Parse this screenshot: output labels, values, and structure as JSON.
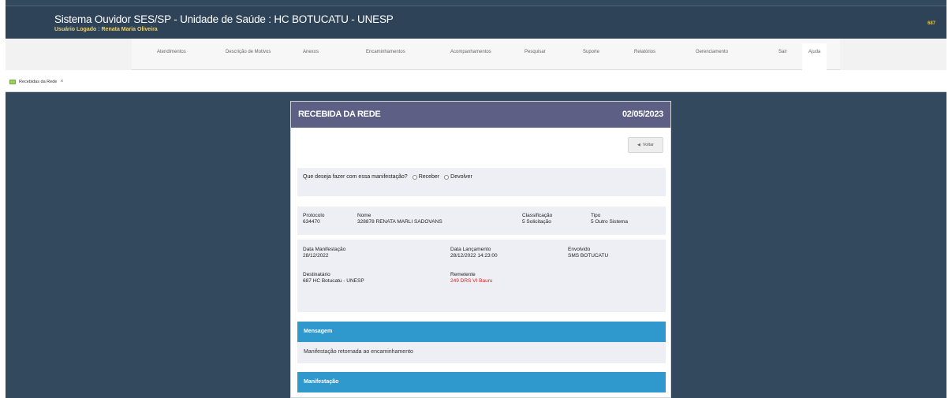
{
  "header": {
    "title": "Sistema Ouvidor SES/SP - Unidade de Saúde : HC BOTUCATU - UNESP",
    "user_label": "Usuário Logado : ",
    "user_name": "Renata Maria Oliveira",
    "code": "687"
  },
  "nav": {
    "items": [
      "Atendimentos",
      "Descrição de Motivos",
      "Anexos",
      "Encaminhamentos",
      "Acompanhamentos",
      "Pesquisar",
      "Suporte",
      "Relatórios",
      "Gerenciamento",
      "Sair",
      "Ajuda"
    ]
  },
  "tabs": [
    {
      "label": "Recebidas da Rede",
      "close": "×"
    }
  ],
  "card": {
    "title": "RECEBIDA DA REDE",
    "date": "02/05/2023",
    "back_label": "Voltar",
    "question": "Que deseja fazer com essa manifestação?",
    "options": [
      "Receber",
      "Devolver"
    ],
    "protocolo": {
      "label": "Protocolo",
      "value": "634470"
    },
    "nome": {
      "label": "Nome",
      "value": "328878 RENATA MARLI SADOVANS"
    },
    "classificacao": {
      "label": "Classificação",
      "value": "5 Solicitação"
    },
    "tipo": {
      "label": "Tipo",
      "value": "5 Outro Sistema"
    },
    "data_manifestacao": {
      "label": "Data Manifestação",
      "value": "28/12/2022"
    },
    "data_lancamento": {
      "label": "Data Lançamento",
      "value": "28/12/2022 14:23:00"
    },
    "envolvido": {
      "label": "Envolvido",
      "value": "SMS BOTUCATU"
    },
    "destinatario": {
      "label": "Destinatário",
      "value": "687 HC Botucatu - UNESP"
    },
    "remetente": {
      "label": "Remetente",
      "value": "249 DRS VI Bauru"
    },
    "mensagem": {
      "title": "Mensagem",
      "text": "Manifestação retornada ao encaminhamento"
    },
    "manifestacao": {
      "title": "Manifestação"
    }
  },
  "colors": {
    "background": "#334a5e",
    "card_header": "#5e5f85",
    "section_header": "#2f98cd",
    "remetente_value": "#e02020"
  }
}
